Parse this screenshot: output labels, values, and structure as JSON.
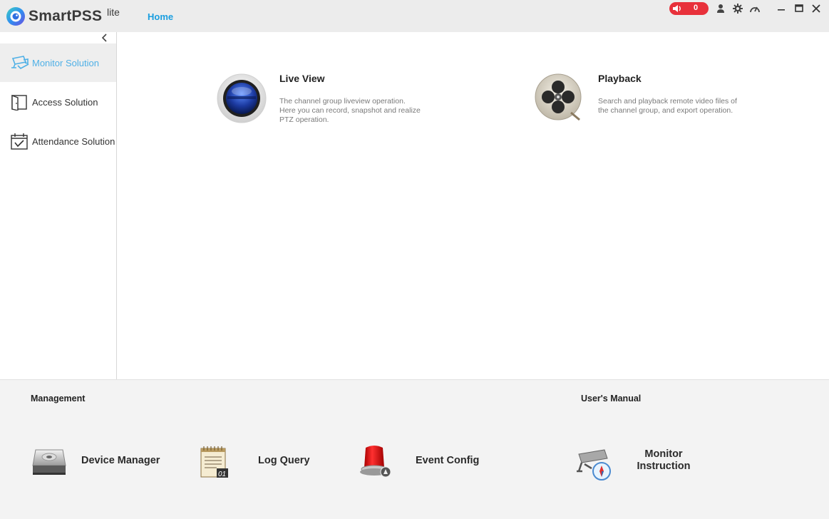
{
  "titlebar": {
    "app_name": "SmartPSS",
    "app_suffix": "lite",
    "home_tab": "Home",
    "alarm_count": "0",
    "icons": [
      "user-icon",
      "gear-icon",
      "speedometer-icon"
    ],
    "window_buttons": [
      "minimize-icon",
      "maximize-icon",
      "close-icon"
    ],
    "accent_color": "#1a9ee0",
    "alarm_color": "#e8313b"
  },
  "sidebar": {
    "items": [
      {
        "label": "Monitor Solution",
        "icon": "cctv-camera-icon",
        "active": true
      },
      {
        "label": "Access Solution",
        "icon": "door-icon",
        "active": false
      },
      {
        "label": "Attendance Solution",
        "icon": "calendar-check-icon",
        "active": false
      }
    ]
  },
  "main": {
    "functions": [
      {
        "title": "Live View",
        "description": "The channel group liveview operation. Here you can record, snapshot and realize PTZ operation.",
        "icon": "live-view-lens-icon"
      },
      {
        "title": "Playback",
        "description": "Search and playback remote video files of the channel group, and export operation.",
        "icon": "film-reel-icon"
      }
    ]
  },
  "management": {
    "title": "Management",
    "items": [
      {
        "label": "Device Manager",
        "icon": "device-manager-icon"
      },
      {
        "label": "Log Query",
        "icon": "log-notepad-icon"
      },
      {
        "label": "Event Config",
        "icon": "alarm-siren-icon"
      }
    ]
  },
  "manual": {
    "title": "User's Manual",
    "items": [
      {
        "label_line1": "Monitor",
        "label_line2": "Instruction",
        "icon": "camera-compass-icon"
      }
    ]
  }
}
